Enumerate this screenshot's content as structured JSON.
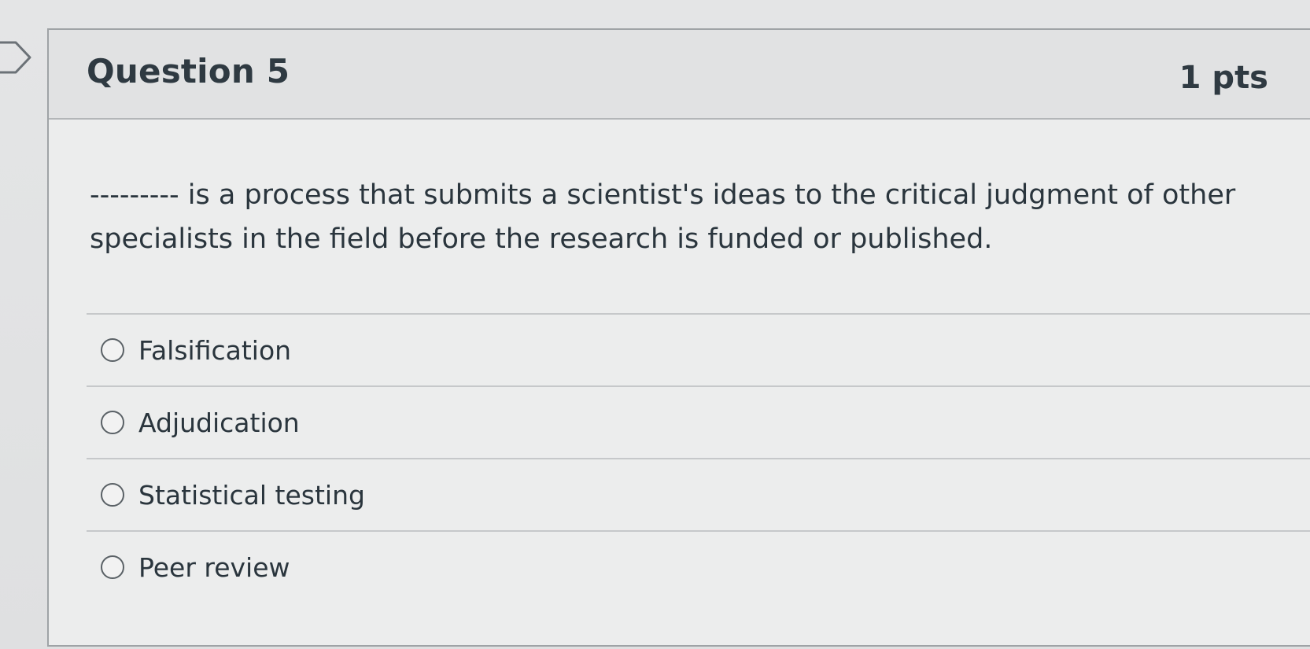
{
  "question": {
    "title": "Question 5",
    "points": "1 pts",
    "text": "--------- is a process that submits a scientist's ideas to the critical judgment of other specialists in the field before the research is funded or published."
  },
  "answers": [
    {
      "label": "Falsification"
    },
    {
      "label": "Adjudication"
    },
    {
      "label": "Statistical testing"
    },
    {
      "label": "Peer review"
    }
  ],
  "icons": {
    "flag": "flag-marker-icon",
    "radio": "radio-unselected-icon"
  },
  "colors": {
    "background": "#e4e5e6",
    "header": "#e1e2e3",
    "text": "#2d3b45",
    "border": "#9fa3a6"
  }
}
